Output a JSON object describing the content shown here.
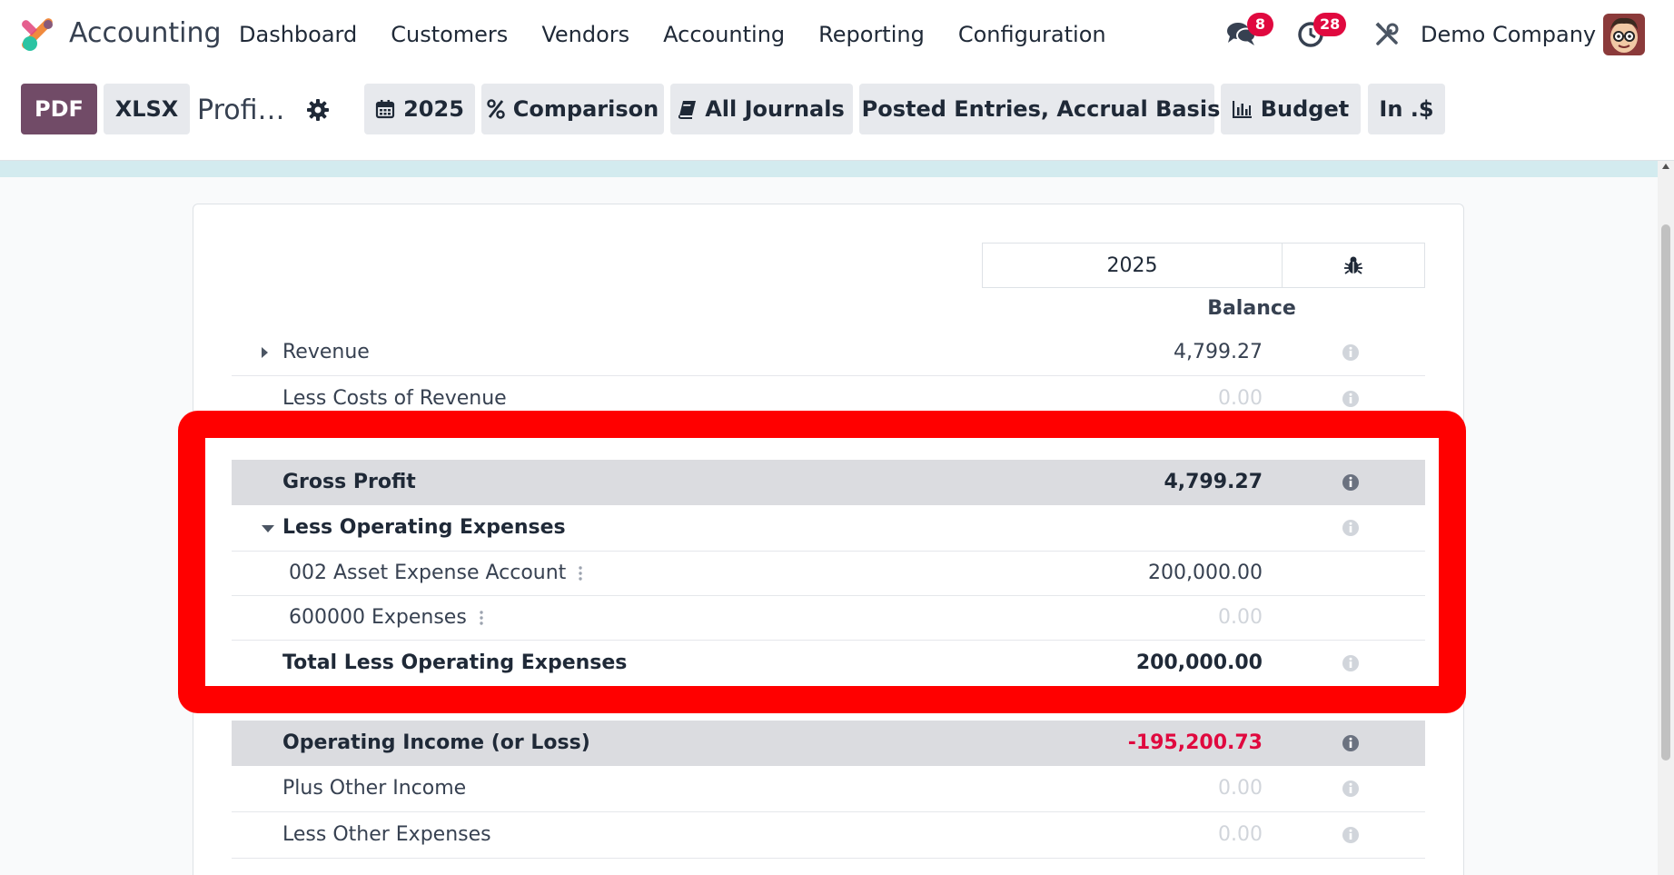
{
  "navbar": {
    "app_name": "Accounting",
    "menu": [
      "Dashboard",
      "Customers",
      "Vendors",
      "Accounting",
      "Reporting",
      "Configuration"
    ],
    "messages_icon": "chat-bubbles-icon",
    "messages_count": "8",
    "activities_icon": "clock-icon",
    "activities_count": "28",
    "tools_icon": "wrench-screwdriver-icon",
    "company": "Demo Company"
  },
  "control_panel": {
    "pdf_label": "PDF",
    "xlsx_label": "XLSX",
    "report_title": "Profi…",
    "filters": [
      {
        "icon": "calendar-icon",
        "label": "2025"
      },
      {
        "icon": "percent-icon",
        "label": "Comparison"
      },
      {
        "icon": "book-icon",
        "label": "All Journals"
      },
      {
        "icon": "sliders-icon",
        "label": "Posted Entries, Accrual Basis"
      },
      {
        "icon": "bar-chart-icon",
        "label": "Budget"
      },
      {
        "icon": "",
        "label": "In .$"
      }
    ]
  },
  "report": {
    "column_period": "2025",
    "column_subheader": "Balance",
    "debug_icon": "bug-icon",
    "lines": [
      {
        "label": "Revenue",
        "value": "4,799.27"
      },
      {
        "label": "Less Costs of Revenue",
        "value": "0.00"
      },
      {
        "label": "Gross Profit",
        "value": "4,799.27"
      },
      {
        "label": "Less Operating Expenses",
        "value": ""
      },
      {
        "label": "002 Asset Expense Account",
        "value": "200,000.00"
      },
      {
        "label": "600000 Expenses",
        "value": "0.00"
      },
      {
        "label": "Total Less Operating Expenses",
        "value": "200,000.00"
      },
      {
        "label": "Operating Income (or Loss)",
        "value": "-195,200.73"
      },
      {
        "label": "Plus Other Income",
        "value": "0.00"
      },
      {
        "label": "Less Other Expenses",
        "value": "0.00"
      }
    ]
  },
  "colors": {
    "brand": "#714b67",
    "badge": "#e0093f",
    "negative": "#e0093f",
    "highlight": "#ff0000",
    "total_row": "#dbdce0"
  }
}
